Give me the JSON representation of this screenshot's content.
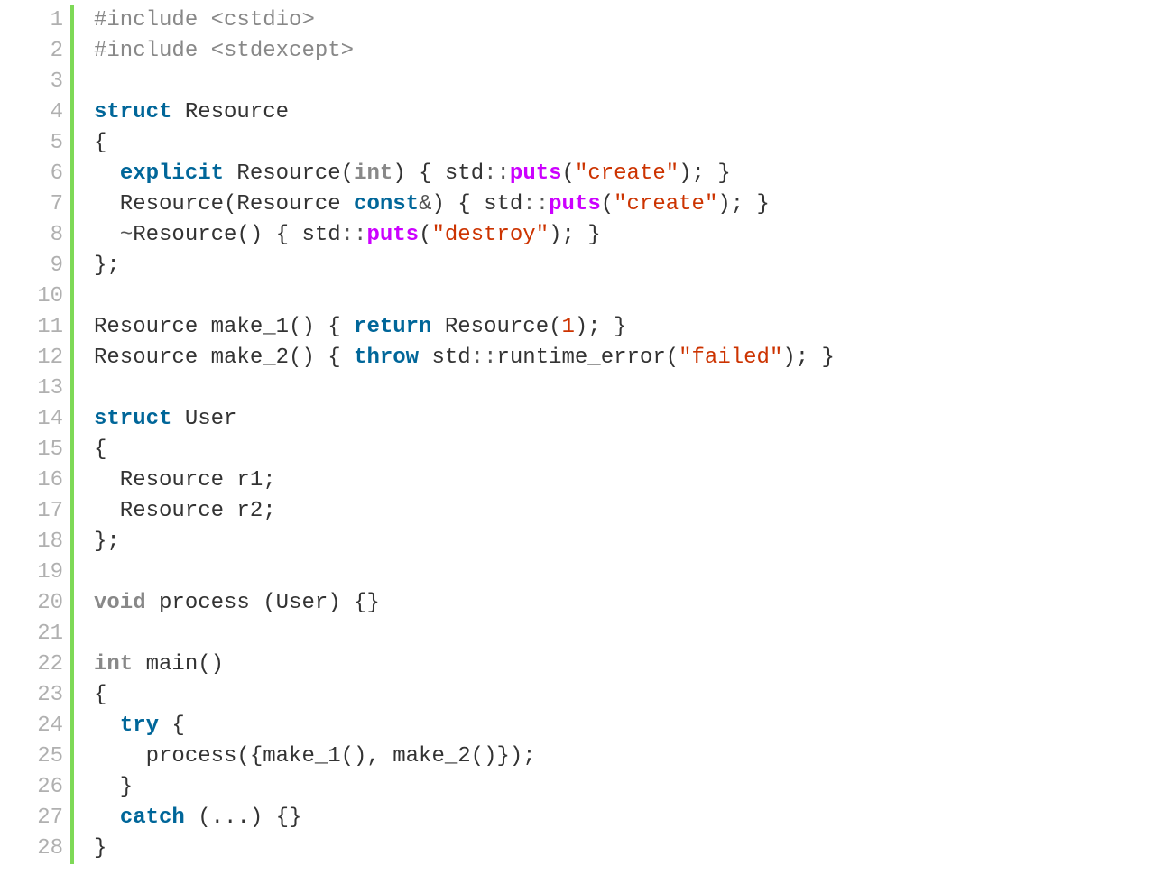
{
  "code": {
    "language": "cpp",
    "line_numbers": [
      "1",
      "2",
      "3",
      "4",
      "5",
      "6",
      "7",
      "8",
      "9",
      "10",
      "11",
      "12",
      "13",
      "14",
      "15",
      "16",
      "17",
      "18",
      "19",
      "20",
      "21",
      "22",
      "23",
      "24",
      "25",
      "26",
      "27",
      "28"
    ],
    "lines": [
      [
        {
          "c": "pp",
          "t": "#include <cstdio>"
        }
      ],
      [
        {
          "c": "pp",
          "t": "#include <stdexcept>"
        }
      ],
      [],
      [
        {
          "c": "kw",
          "t": "struct"
        },
        {
          "c": "plain",
          "t": " Resource"
        }
      ],
      [
        {
          "c": "plain",
          "t": "{"
        }
      ],
      [
        {
          "c": "plain",
          "t": "  "
        },
        {
          "c": "kw",
          "t": "explicit"
        },
        {
          "c": "plain",
          "t": " Resource("
        },
        {
          "c": "type",
          "t": "int"
        },
        {
          "c": "plain",
          "t": ") { std"
        },
        {
          "c": "op",
          "t": "::"
        },
        {
          "c": "fn",
          "t": "puts"
        },
        {
          "c": "plain",
          "t": "("
        },
        {
          "c": "str",
          "t": "\"create\""
        },
        {
          "c": "plain",
          "t": "); }"
        }
      ],
      [
        {
          "c": "plain",
          "t": "  Resource(Resource "
        },
        {
          "c": "kw",
          "t": "const"
        },
        {
          "c": "op",
          "t": "&"
        },
        {
          "c": "plain",
          "t": ") { std"
        },
        {
          "c": "op",
          "t": "::"
        },
        {
          "c": "fn",
          "t": "puts"
        },
        {
          "c": "plain",
          "t": "("
        },
        {
          "c": "str",
          "t": "\"create\""
        },
        {
          "c": "plain",
          "t": "); }"
        }
      ],
      [
        {
          "c": "plain",
          "t": "  "
        },
        {
          "c": "op",
          "t": "~"
        },
        {
          "c": "plain",
          "t": "Resource() { std"
        },
        {
          "c": "op",
          "t": "::"
        },
        {
          "c": "fn",
          "t": "puts"
        },
        {
          "c": "plain",
          "t": "("
        },
        {
          "c": "str",
          "t": "\"destroy\""
        },
        {
          "c": "plain",
          "t": "); }"
        }
      ],
      [
        {
          "c": "plain",
          "t": "};"
        }
      ],
      [],
      [
        {
          "c": "plain",
          "t": "Resource make_1() { "
        },
        {
          "c": "kw",
          "t": "return"
        },
        {
          "c": "plain",
          "t": " Resource("
        },
        {
          "c": "str",
          "t": "1"
        },
        {
          "c": "plain",
          "t": "); }"
        }
      ],
      [
        {
          "c": "plain",
          "t": "Resource make_2() { "
        },
        {
          "c": "kw",
          "t": "throw"
        },
        {
          "c": "plain",
          "t": " std"
        },
        {
          "c": "op",
          "t": "::"
        },
        {
          "c": "plain",
          "t": "runtime_error("
        },
        {
          "c": "str",
          "t": "\"failed\""
        },
        {
          "c": "plain",
          "t": "); }"
        }
      ],
      [],
      [
        {
          "c": "kw",
          "t": "struct"
        },
        {
          "c": "plain",
          "t": " User"
        }
      ],
      [
        {
          "c": "plain",
          "t": "{"
        }
      ],
      [
        {
          "c": "plain",
          "t": "  Resource r1;"
        }
      ],
      [
        {
          "c": "plain",
          "t": "  Resource r2;"
        }
      ],
      [
        {
          "c": "plain",
          "t": "};"
        }
      ],
      [],
      [
        {
          "c": "type",
          "t": "void"
        },
        {
          "c": "plain",
          "t": " process (User) {}"
        }
      ],
      [],
      [
        {
          "c": "type",
          "t": "int"
        },
        {
          "c": "plain",
          "t": " main()"
        }
      ],
      [
        {
          "c": "plain",
          "t": "{"
        }
      ],
      [
        {
          "c": "plain",
          "t": "  "
        },
        {
          "c": "kw",
          "t": "try"
        },
        {
          "c": "plain",
          "t": " {"
        }
      ],
      [
        {
          "c": "plain",
          "t": "    process({make_1(), make_2()});"
        }
      ],
      [
        {
          "c": "plain",
          "t": "  }"
        }
      ],
      [
        {
          "c": "plain",
          "t": "  "
        },
        {
          "c": "kw",
          "t": "catch"
        },
        {
          "c": "plain",
          "t": " (...) {}"
        }
      ],
      [
        {
          "c": "plain",
          "t": "}"
        }
      ]
    ]
  }
}
